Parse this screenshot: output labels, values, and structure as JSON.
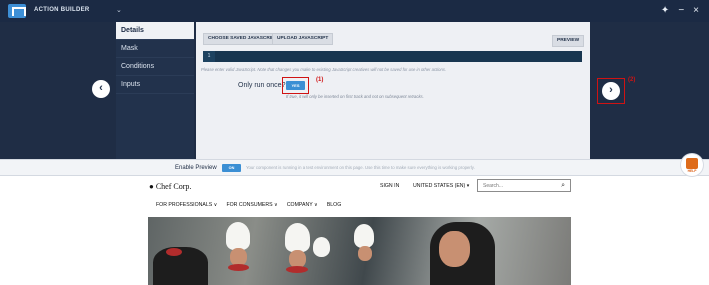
{
  "top_bar": {
    "title": "ACTION BUILDER",
    "menu_icon": "chevron-down-icon",
    "actions": [
      {
        "label": "✦",
        "name": "pin-icon"
      },
      {
        "label": "−",
        "name": "minimize-icon"
      },
      {
        "label": "×",
        "name": "close-icon"
      }
    ]
  },
  "sidebar": {
    "items": [
      {
        "label": "Details",
        "active": true
      },
      {
        "label": "Mask",
        "active": false
      },
      {
        "label": "Conditions",
        "active": false
      },
      {
        "label": "Inputs",
        "active": false
      }
    ]
  },
  "details": {
    "choose_button": "CHOOSE SAVED JAVASCRIPT",
    "upload_button": "UPLOAD JAVASCRIPT",
    "preview_button": "PREVIEW",
    "line_number": "1",
    "helper_text": "Please enter valid JavaScript. Note that changes you make to existing JavaScript creatives will not be saved for use in other actions.",
    "run_once_label": "Only run once?",
    "run_once_value": "YES",
    "run_once_help": "If true, it will only be inserted on first track and not on subsequent retracks."
  },
  "annotations": {
    "one": "(1)",
    "two": "(2)"
  },
  "navigation": {
    "previous_icon": "chevron-left-icon",
    "next_icon": "chevron-right-icon"
  },
  "preview_bar": {
    "label": "Enable Preview",
    "toggle": "ON",
    "note": "Your component is running in a test environment on this page. Use this time to make sure everything is working properly."
  },
  "help": {
    "label": "HELP"
  },
  "website": {
    "logo": "Chef Corp.",
    "sign_in": "SIGN IN",
    "region": "UNITED STATES (EN)",
    "search_placeholder": "Search...",
    "nav": [
      "FOR PROFESSIONALS ∨",
      "FOR CONSUMERS ∨",
      "COMPANY ∨",
      "BLOG"
    ]
  },
  "colors": {
    "topbar": "#1b2a44",
    "editor_background": "#1f2d45",
    "accent": "#3b8fd4",
    "annotation": "#d01313",
    "help_orange": "#de6b1a"
  }
}
